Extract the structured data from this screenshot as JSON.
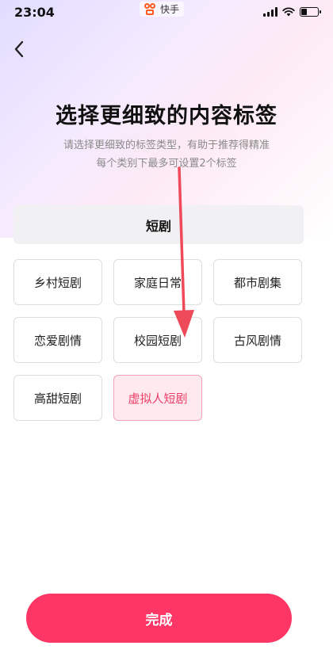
{
  "status_bar": {
    "time": "23:04",
    "app_name": "快手",
    "battery_level": 0.35
  },
  "header": {
    "back_icon": "chevron-left-icon",
    "title": "选择更细致的内容标签",
    "subtitle_line1": "请选择更细致的标签类型，有助于推荐得精准",
    "subtitle_line2": "每个类别下最多可设置2个标签"
  },
  "category": {
    "name": "短剧",
    "tags": [
      {
        "label": "乡村短剧",
        "selected": false
      },
      {
        "label": "家庭日常",
        "selected": false
      },
      {
        "label": "都市剧集",
        "selected": false
      },
      {
        "label": "恋爱剧情",
        "selected": false
      },
      {
        "label": "校园短剧",
        "selected": false
      },
      {
        "label": "古风剧情",
        "selected": false
      },
      {
        "label": "高甜短剧",
        "selected": false
      },
      {
        "label": "虚拟人短剧",
        "selected": true
      }
    ]
  },
  "footer": {
    "done_label": "完成"
  },
  "colors": {
    "accent": "#fe3666",
    "selected_text": "#ee3e67",
    "selected_bg": "#fde9ee",
    "annotation_arrow": "#ee4a5a"
  }
}
